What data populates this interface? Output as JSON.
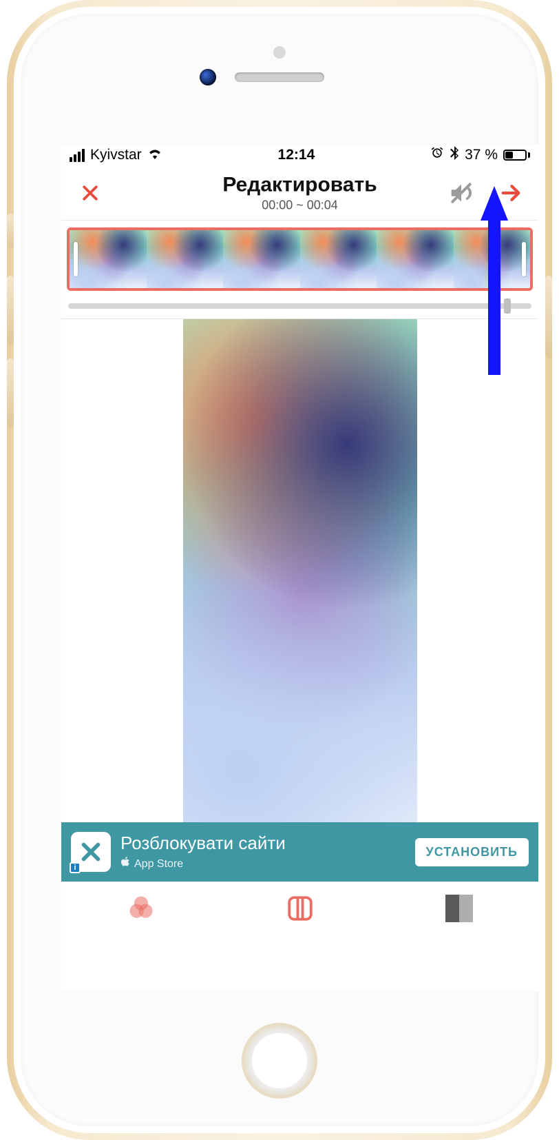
{
  "status": {
    "carrier": "Kyivstar",
    "time": "12:14",
    "battery_pct": "37 %"
  },
  "nav": {
    "title": "Редактировать",
    "range": "00:00 ~ 00:04"
  },
  "ad": {
    "title": "Розблокувати сайти",
    "store_label": "App Store",
    "cta": "УСТАНОВИТЬ",
    "info_badge": "i"
  },
  "colors": {
    "accent": "#e74c3c",
    "ad_bg": "#3f97a3",
    "annotation": "#1414ff"
  }
}
